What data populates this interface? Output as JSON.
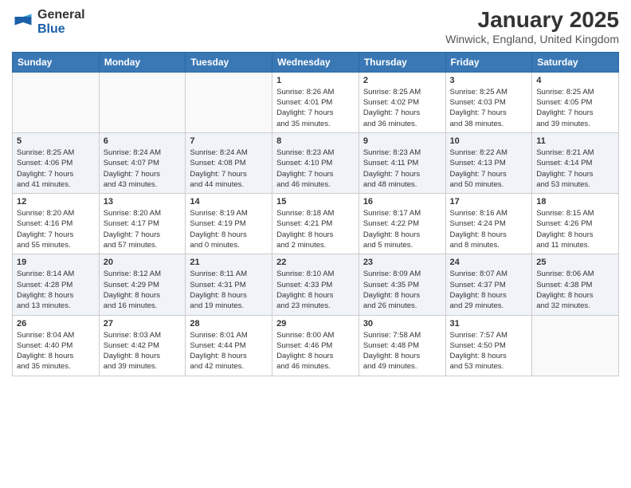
{
  "logo": {
    "general": "General",
    "blue": "Blue"
  },
  "header": {
    "month_year": "January 2025",
    "location": "Winwick, England, United Kingdom"
  },
  "weekdays": [
    "Sunday",
    "Monday",
    "Tuesday",
    "Wednesday",
    "Thursday",
    "Friday",
    "Saturday"
  ],
  "weeks": [
    [
      {
        "day": "",
        "info": ""
      },
      {
        "day": "",
        "info": ""
      },
      {
        "day": "",
        "info": ""
      },
      {
        "day": "1",
        "info": "Sunrise: 8:26 AM\nSunset: 4:01 PM\nDaylight: 7 hours\nand 35 minutes."
      },
      {
        "day": "2",
        "info": "Sunrise: 8:25 AM\nSunset: 4:02 PM\nDaylight: 7 hours\nand 36 minutes."
      },
      {
        "day": "3",
        "info": "Sunrise: 8:25 AM\nSunset: 4:03 PM\nDaylight: 7 hours\nand 38 minutes."
      },
      {
        "day": "4",
        "info": "Sunrise: 8:25 AM\nSunset: 4:05 PM\nDaylight: 7 hours\nand 39 minutes."
      }
    ],
    [
      {
        "day": "5",
        "info": "Sunrise: 8:25 AM\nSunset: 4:06 PM\nDaylight: 7 hours\nand 41 minutes."
      },
      {
        "day": "6",
        "info": "Sunrise: 8:24 AM\nSunset: 4:07 PM\nDaylight: 7 hours\nand 43 minutes."
      },
      {
        "day": "7",
        "info": "Sunrise: 8:24 AM\nSunset: 4:08 PM\nDaylight: 7 hours\nand 44 minutes."
      },
      {
        "day": "8",
        "info": "Sunrise: 8:23 AM\nSunset: 4:10 PM\nDaylight: 7 hours\nand 46 minutes."
      },
      {
        "day": "9",
        "info": "Sunrise: 8:23 AM\nSunset: 4:11 PM\nDaylight: 7 hours\nand 48 minutes."
      },
      {
        "day": "10",
        "info": "Sunrise: 8:22 AM\nSunset: 4:13 PM\nDaylight: 7 hours\nand 50 minutes."
      },
      {
        "day": "11",
        "info": "Sunrise: 8:21 AM\nSunset: 4:14 PM\nDaylight: 7 hours\nand 53 minutes."
      }
    ],
    [
      {
        "day": "12",
        "info": "Sunrise: 8:20 AM\nSunset: 4:16 PM\nDaylight: 7 hours\nand 55 minutes."
      },
      {
        "day": "13",
        "info": "Sunrise: 8:20 AM\nSunset: 4:17 PM\nDaylight: 7 hours\nand 57 minutes."
      },
      {
        "day": "14",
        "info": "Sunrise: 8:19 AM\nSunset: 4:19 PM\nDaylight: 8 hours\nand 0 minutes."
      },
      {
        "day": "15",
        "info": "Sunrise: 8:18 AM\nSunset: 4:21 PM\nDaylight: 8 hours\nand 2 minutes."
      },
      {
        "day": "16",
        "info": "Sunrise: 8:17 AM\nSunset: 4:22 PM\nDaylight: 8 hours\nand 5 minutes."
      },
      {
        "day": "17",
        "info": "Sunrise: 8:16 AM\nSunset: 4:24 PM\nDaylight: 8 hours\nand 8 minutes."
      },
      {
        "day": "18",
        "info": "Sunrise: 8:15 AM\nSunset: 4:26 PM\nDaylight: 8 hours\nand 11 minutes."
      }
    ],
    [
      {
        "day": "19",
        "info": "Sunrise: 8:14 AM\nSunset: 4:28 PM\nDaylight: 8 hours\nand 13 minutes."
      },
      {
        "day": "20",
        "info": "Sunrise: 8:12 AM\nSunset: 4:29 PM\nDaylight: 8 hours\nand 16 minutes."
      },
      {
        "day": "21",
        "info": "Sunrise: 8:11 AM\nSunset: 4:31 PM\nDaylight: 8 hours\nand 19 minutes."
      },
      {
        "day": "22",
        "info": "Sunrise: 8:10 AM\nSunset: 4:33 PM\nDaylight: 8 hours\nand 23 minutes."
      },
      {
        "day": "23",
        "info": "Sunrise: 8:09 AM\nSunset: 4:35 PM\nDaylight: 8 hours\nand 26 minutes."
      },
      {
        "day": "24",
        "info": "Sunrise: 8:07 AM\nSunset: 4:37 PM\nDaylight: 8 hours\nand 29 minutes."
      },
      {
        "day": "25",
        "info": "Sunrise: 8:06 AM\nSunset: 4:38 PM\nDaylight: 8 hours\nand 32 minutes."
      }
    ],
    [
      {
        "day": "26",
        "info": "Sunrise: 8:04 AM\nSunset: 4:40 PM\nDaylight: 8 hours\nand 35 minutes."
      },
      {
        "day": "27",
        "info": "Sunrise: 8:03 AM\nSunset: 4:42 PM\nDaylight: 8 hours\nand 39 minutes."
      },
      {
        "day": "28",
        "info": "Sunrise: 8:01 AM\nSunset: 4:44 PM\nDaylight: 8 hours\nand 42 minutes."
      },
      {
        "day": "29",
        "info": "Sunrise: 8:00 AM\nSunset: 4:46 PM\nDaylight: 8 hours\nand 46 minutes."
      },
      {
        "day": "30",
        "info": "Sunrise: 7:58 AM\nSunset: 4:48 PM\nDaylight: 8 hours\nand 49 minutes."
      },
      {
        "day": "31",
        "info": "Sunrise: 7:57 AM\nSunset: 4:50 PM\nDaylight: 8 hours\nand 53 minutes."
      },
      {
        "day": "",
        "info": ""
      }
    ]
  ]
}
